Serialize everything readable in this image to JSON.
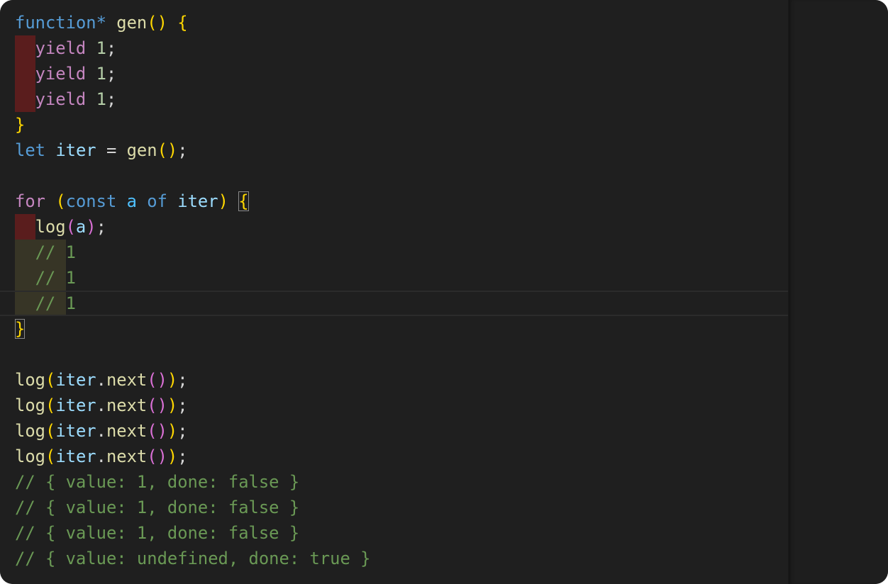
{
  "editor": {
    "lines": [
      [
        {
          "t": "function",
          "c": "kw"
        },
        {
          "t": "*",
          "c": "kw"
        },
        {
          "t": " ",
          "c": "punc"
        },
        {
          "t": "gen",
          "c": "fn"
        },
        {
          "t": "()",
          "c": "b1"
        },
        {
          "t": " ",
          "c": "punc"
        },
        {
          "t": "{",
          "c": "b1"
        }
      ],
      [
        {
          "ind": "err"
        },
        {
          "t": "yield",
          "c": "ctl"
        },
        {
          "t": " ",
          "c": "punc"
        },
        {
          "t": "1",
          "c": "num"
        },
        {
          "t": ";",
          "c": "punc"
        }
      ],
      [
        {
          "ind": "err"
        },
        {
          "t": "yield",
          "c": "ctl"
        },
        {
          "t": " ",
          "c": "punc"
        },
        {
          "t": "1",
          "c": "num"
        },
        {
          "t": ";",
          "c": "punc"
        }
      ],
      [
        {
          "ind": "err"
        },
        {
          "t": "yield",
          "c": "ctl"
        },
        {
          "t": " ",
          "c": "punc"
        },
        {
          "t": "1",
          "c": "num"
        },
        {
          "t": ";",
          "c": "punc"
        }
      ],
      [
        {
          "t": "}",
          "c": "b1"
        }
      ],
      [
        {
          "t": "let",
          "c": "kw"
        },
        {
          "t": " ",
          "c": "punc"
        },
        {
          "t": "iter",
          "c": "var"
        },
        {
          "t": " = ",
          "c": "punc"
        },
        {
          "t": "gen",
          "c": "fn"
        },
        {
          "t": "()",
          "c": "b1"
        },
        {
          "t": ";",
          "c": "punc"
        }
      ],
      [],
      [
        {
          "t": "for",
          "c": "ctl"
        },
        {
          "t": " ",
          "c": "punc"
        },
        {
          "t": "(",
          "c": "b1"
        },
        {
          "t": "const",
          "c": "kw"
        },
        {
          "t": " ",
          "c": "punc"
        },
        {
          "t": "a",
          "c": "cst"
        },
        {
          "t": " ",
          "c": "punc"
        },
        {
          "t": "of",
          "c": "kw"
        },
        {
          "t": " ",
          "c": "punc"
        },
        {
          "t": "iter",
          "c": "var"
        },
        {
          "t": ")",
          "c": "b1"
        },
        {
          "t": " ",
          "c": "punc"
        },
        {
          "t": "{",
          "c": "b1",
          "bm": true
        }
      ],
      [
        {
          "ind": "err"
        },
        {
          "t": "log",
          "c": "fn"
        },
        {
          "t": "(",
          "c": "b2"
        },
        {
          "t": "a",
          "c": "var"
        },
        {
          "t": ")",
          "c": "b2"
        },
        {
          "t": ";",
          "c": "punc"
        }
      ],
      [
        {
          "ind": "warn"
        },
        {
          "w": "// "
        },
        {
          "t": "1",
          "c": "cmt"
        }
      ],
      [
        {
          "ind": "warn"
        },
        {
          "w": "// "
        },
        {
          "t": "1",
          "c": "cmt"
        }
      ],
      [
        {
          "ind": "warn"
        },
        {
          "w": "// "
        },
        {
          "t": "1",
          "c": "cmt"
        }
      ],
      [
        {
          "t": "}",
          "c": "b1",
          "bm": true
        }
      ],
      [],
      [
        {
          "t": "log",
          "c": "fn"
        },
        {
          "t": "(",
          "c": "b1"
        },
        {
          "t": "iter",
          "c": "var"
        },
        {
          "t": ".",
          "c": "punc"
        },
        {
          "t": "next",
          "c": "fn"
        },
        {
          "t": "()",
          "c": "b2"
        },
        {
          "t": ")",
          "c": "b1"
        },
        {
          "t": ";",
          "c": "punc"
        }
      ],
      [
        {
          "t": "log",
          "c": "fn"
        },
        {
          "t": "(",
          "c": "b1"
        },
        {
          "t": "iter",
          "c": "var"
        },
        {
          "t": ".",
          "c": "punc"
        },
        {
          "t": "next",
          "c": "fn"
        },
        {
          "t": "()",
          "c": "b2"
        },
        {
          "t": ")",
          "c": "b1"
        },
        {
          "t": ";",
          "c": "punc"
        }
      ],
      [
        {
          "t": "log",
          "c": "fn"
        },
        {
          "t": "(",
          "c": "b1"
        },
        {
          "t": "iter",
          "c": "var"
        },
        {
          "t": ".",
          "c": "punc"
        },
        {
          "t": "next",
          "c": "fn"
        },
        {
          "t": "()",
          "c": "b2"
        },
        {
          "t": ")",
          "c": "b1"
        },
        {
          "t": ";",
          "c": "punc"
        }
      ],
      [
        {
          "t": "log",
          "c": "fn"
        },
        {
          "t": "(",
          "c": "b1"
        },
        {
          "t": "iter",
          "c": "var"
        },
        {
          "t": ".",
          "c": "punc"
        },
        {
          "t": "next",
          "c": "fn"
        },
        {
          "t": "()",
          "c": "b2"
        },
        {
          "t": ")",
          "c": "b1"
        },
        {
          "t": ";",
          "c": "punc"
        }
      ],
      [
        {
          "t": "// { value: 1, done: false }",
          "c": "cmt"
        }
      ],
      [
        {
          "t": "// { value: 1, done: false }",
          "c": "cmt"
        }
      ],
      [
        {
          "t": "// { value: 1, done: false }",
          "c": "cmt"
        }
      ],
      [
        {
          "t": "// { value: undefined, done: true }",
          "c": "cmt"
        }
      ]
    ],
    "current_line": 12
  },
  "colors": {
    "background": "#1f1f1f",
    "keyword": "#569cd6",
    "control": "#c586c0",
    "function": "#dcdcaa",
    "variable": "#9cdcfe",
    "constant": "#4fc1ff",
    "number": "#b5cea8",
    "comment": "#6a9955",
    "bracket_level1": "#ffd700",
    "bracket_level2": "#da70d6",
    "indent_error": "#5a1d1d",
    "indent_warning": "#373526"
  }
}
